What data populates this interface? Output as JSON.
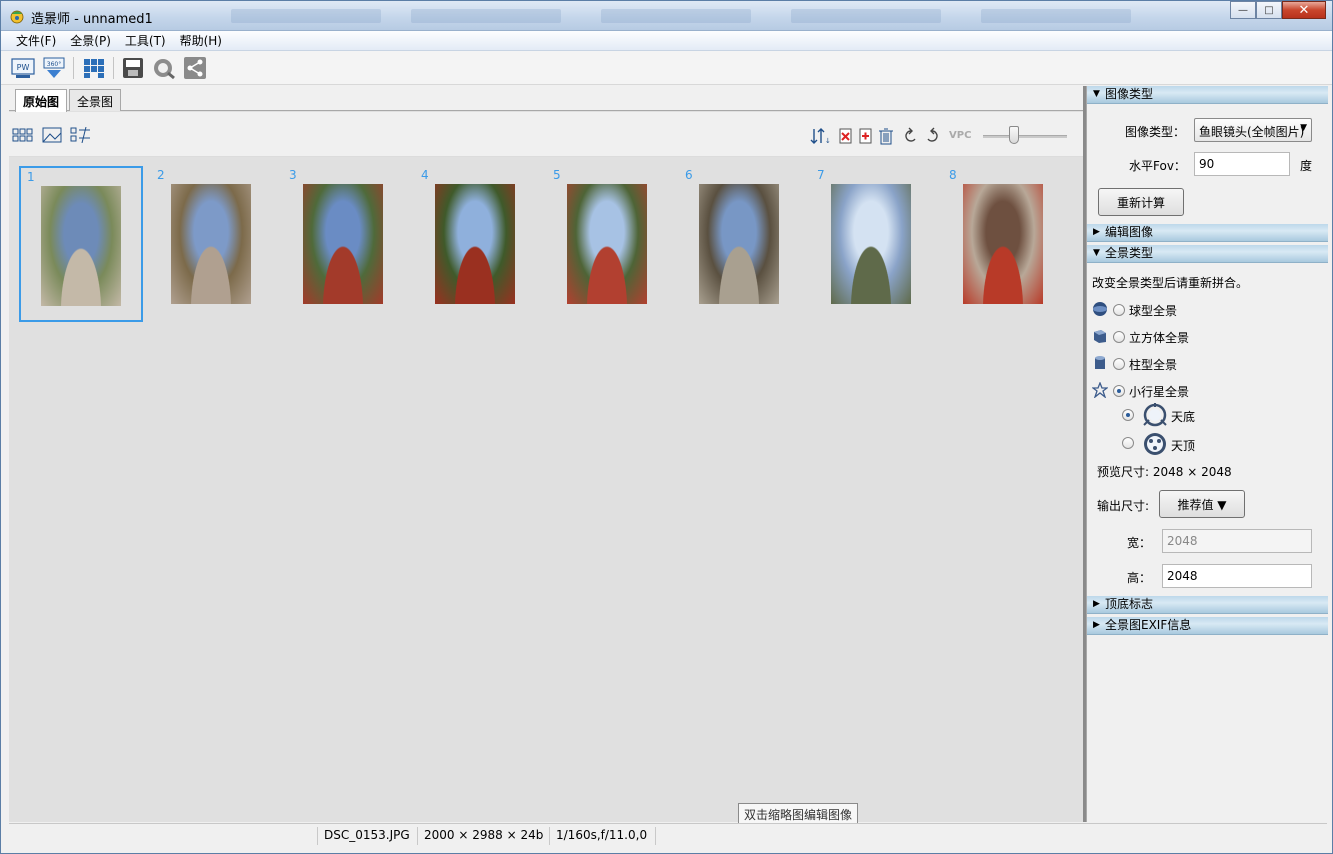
{
  "window": {
    "title": "造景师 - unnamed1",
    "minimize_glyph": "—",
    "maximize_glyph": "□",
    "close_glyph": "✕"
  },
  "menu": [
    "文件(F)",
    "全景(P)",
    "工具(T)",
    "帮助(H)"
  ],
  "toolbar": {
    "buttons": [
      "publish-pw-icon",
      "export-360-icon",
      "stitch-icon",
      "save-360-icon",
      "search-globe-icon",
      "share-icon"
    ],
    "pw_label": "PW",
    "b360_label": "360°"
  },
  "tabs": [
    "原始图",
    "全景图"
  ],
  "image_toolbar": {
    "vpc_label": "VPC",
    "zoom_slider_fraction": 0.35
  },
  "thumbnails": [
    {
      "num": "1",
      "selected": true
    },
    {
      "num": "2",
      "selected": false
    },
    {
      "num": "3",
      "selected": false
    },
    {
      "num": "4",
      "selected": false
    },
    {
      "num": "5",
      "selected": false
    },
    {
      "num": "6",
      "selected": false
    },
    {
      "num": "7",
      "selected": false
    },
    {
      "num": "8",
      "selected": false
    }
  ],
  "hint": "双击缩略图编辑图像",
  "status": {
    "filename": "DSC_0153.JPG",
    "dimensions": "2000 × 2988 × 24b",
    "exif": "1/160s,f/11.0,0"
  },
  "right_panel": {
    "image_type_header": "图像类型",
    "image_type_label": "图像类型：",
    "image_type_value": "鱼眼镜头(全帧图片)",
    "hfov_label": "水平Fov：",
    "hfov_value": "90",
    "hfov_unit": "度",
    "recalc_button": "重新计算",
    "edit_image_header": "编辑图像",
    "pano_type_header": "全景类型",
    "pano_type_note": "改变全景类型后请重新拼合。",
    "pano_types": [
      {
        "label": "球型全景",
        "checked": false
      },
      {
        "label": "立方体全景",
        "checked": false
      },
      {
        "label": "柱型全景",
        "checked": false
      },
      {
        "label": "小行星全景",
        "checked": true
      }
    ],
    "planet_options": [
      {
        "label": "天底",
        "checked": true
      },
      {
        "label": "天顶",
        "checked": false
      }
    ],
    "preview_size": "预览尺寸: 2048 × 2048",
    "output_size_label": "输出尺寸:",
    "recommend_button": "推荐值 ▼",
    "width_label": "宽：",
    "width_value": "2048",
    "height_label": "高：",
    "height_value": "2048",
    "zenith_marker_header": "顶底标志",
    "exif_header": "全景图EXIF信息"
  },
  "colors": {
    "accent": "#3b9be8",
    "section_header": "#c3dcec"
  }
}
